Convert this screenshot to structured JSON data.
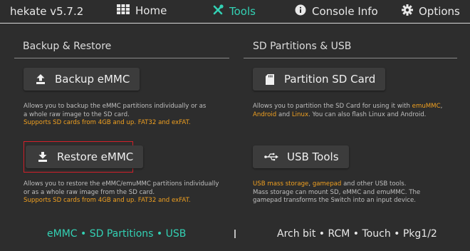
{
  "app": {
    "title": "hekate v5.7.2"
  },
  "nav": {
    "home": "Home",
    "tools": "Tools",
    "console_info": "Console Info",
    "options": "Options"
  },
  "sections": {
    "left_title": "Backup & Restore",
    "right_title": "SD Partitions & USB"
  },
  "buttons": {
    "backup": "Backup eMMC",
    "restore": "Restore eMMC",
    "partition": "Partition SD Card",
    "usb": "USB Tools"
  },
  "descriptions": {
    "backup": {
      "l1": "Allows you to backup the eMMC partitions individually or as",
      "l2": "a whole raw image to the SD card.",
      "l3a": "Supports SD cards from ",
      "l3b": "4GB",
      "l3c": " and up. ",
      "l3d": "FAT32",
      "l3e": " and ",
      "l3f": "exFAT",
      "l3g": "."
    },
    "restore": {
      "l1": "Allows you to restore the eMMC/emuMMC partitions individually",
      "l2": "or as a whole raw image from the SD card.",
      "l3a": "Supports SD cards from ",
      "l3b": "4GB",
      "l3c": " and up. ",
      "l3d": "FAT32",
      "l3e": " and ",
      "l3f": "exFAT",
      "l3g": "."
    },
    "partition": {
      "l1a": "Allows you to partition the SD Card for using it with ",
      "l1b": "emuMMC",
      "l1c": ",",
      "l2a": "Android",
      "l2b": " and ",
      "l2c": "Linux",
      "l2d": ". You can also flash Linux and Android."
    },
    "usb": {
      "l1a": "USB mass storage",
      "l1b": ", ",
      "l1c": "gamepad",
      "l1d": " and other USB tools.",
      "l2": "Mass storage can mount SD, eMMC and emuMMC. The",
      "l3": "gamepad transforms the Switch into an input device."
    }
  },
  "footer": {
    "left": "eMMC • SD Partitions • USB",
    "right": "Arch bit • RCM • Touch • Pkg1/2"
  },
  "colors": {
    "accent": "#33d1b4",
    "highlight": "#f0a020",
    "selection_border": "#d0202a"
  }
}
